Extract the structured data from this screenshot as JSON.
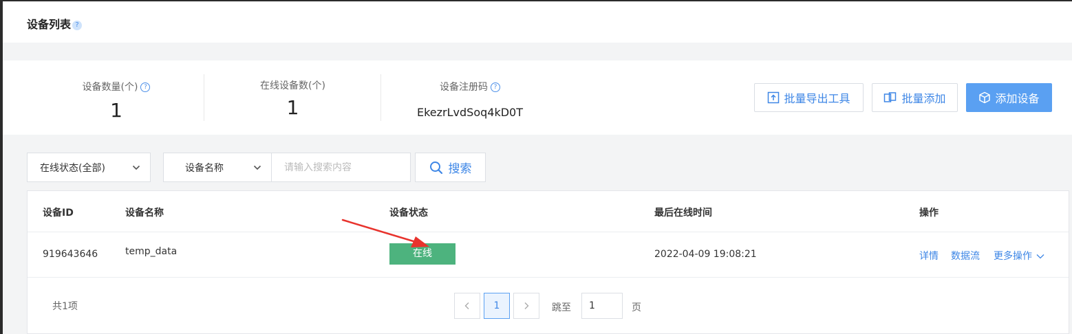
{
  "header": {
    "title": "设备列表",
    "help_icon": "?"
  },
  "stats": {
    "device_count_label": "设备数量(个)",
    "device_count_value": "1",
    "online_count_label": "在线设备数(个)",
    "online_count_value": "1",
    "reg_code_label": "设备注册码",
    "reg_code_value": "EkezrLvdSoq4kD0T",
    "help_icon": "?"
  },
  "actions": {
    "batch_export": "批量导出工具",
    "batch_add": "批量添加",
    "add_device": "添加设备"
  },
  "filters": {
    "status_select": "在线状态(全部)",
    "field_select": "设备名称",
    "search_placeholder": "请输入搜索内容",
    "search_button": "搜索"
  },
  "table": {
    "columns": [
      "设备ID",
      "设备名称",
      "设备状态",
      "最后在线时间",
      "操作"
    ],
    "rows": [
      {
        "id": "919643646",
        "name": "temp_data",
        "status": "在线",
        "last_online": "2022-04-09 19:08:21",
        "ops": [
          "详情",
          "数据流",
          "更多操作"
        ]
      }
    ]
  },
  "pager": {
    "total": "共1项",
    "current_page": "1",
    "jump_label": "跳至",
    "jump_value": "1",
    "page_unit": "页"
  },
  "colors": {
    "accent": "#3d86e6",
    "primary_button": "#5aa0f2",
    "online_status": "#4db37e",
    "annotation_arrow": "#e8332d"
  }
}
